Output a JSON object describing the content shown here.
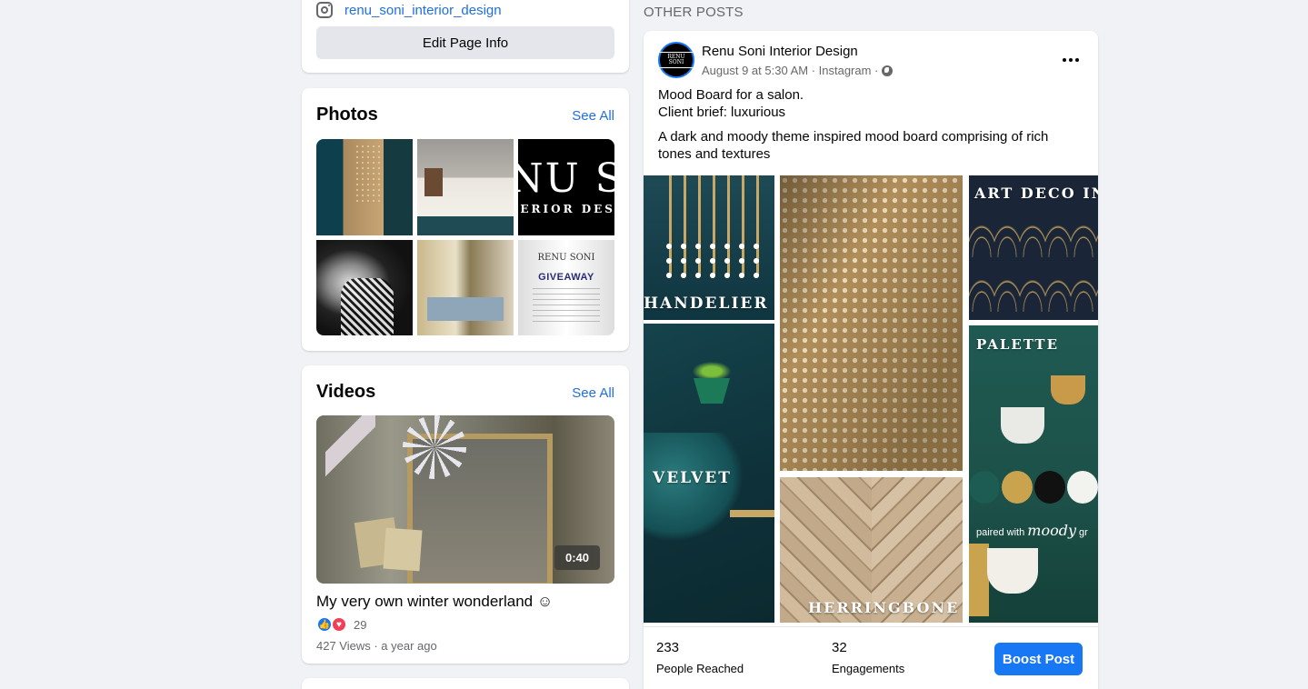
{
  "about": {
    "instagram_handle": "renu_soni_interior_design",
    "edit_button_label": "Edit Page Info"
  },
  "photos": {
    "title": "Photos",
    "see_all": "See All",
    "tile_texts": {
      "logo_big": "NU S",
      "logo_small": "TERIOR DESI",
      "giveaway_brand": "RENU SONI",
      "giveaway_title": "GIVEAWAY"
    }
  },
  "videos": {
    "title": "Videos",
    "see_all": "See All",
    "duration": "0:40",
    "video_title": "My very own winter wonderland ☺",
    "reaction_count": "29",
    "meta": "427 Views · a year ago"
  },
  "other_posts_label": "OTHER POSTS",
  "post": {
    "page_name": "Renu Soni Interior Design",
    "avatar_text": "RENU SONI",
    "meta": "August 9 at 5:30 AM · Instagram ·",
    "text_line1": "Mood Board for a salon.",
    "text_line2": "Client brief: luxurious",
    "text_para2": "A dark and moody theme inspired mood board comprising of rich tones and textures",
    "collage_labels": {
      "chandelier": "HANDELIER",
      "velvet": "VELVET",
      "herringbone": "HERRINGBONE",
      "art_deco": "ART DECO INS",
      "palette": "PALETTE",
      "paired_prefix": "paired with",
      "paired_word": "moody",
      "paired_suffix": "gr"
    },
    "stats": [
      {
        "value": "233",
        "label": "People Reached"
      },
      {
        "value": "32",
        "label": "Engagements"
      }
    ],
    "boost_label": "Boost Post"
  },
  "colors": {
    "link_blue": "#216fdb",
    "primary_blue": "#1877f2",
    "page_bg": "#f0f2f5",
    "secondary_text": "#65676b",
    "swatch_1": "#1d5c52",
    "swatch_2": "#c9a34d",
    "swatch_3": "#111111",
    "swatch_4": "#f2f2ee"
  },
  "icons": [
    "instagram-icon",
    "globe-icon",
    "more-options-icon",
    "like-reaction-icon",
    "love-reaction-icon"
  ]
}
